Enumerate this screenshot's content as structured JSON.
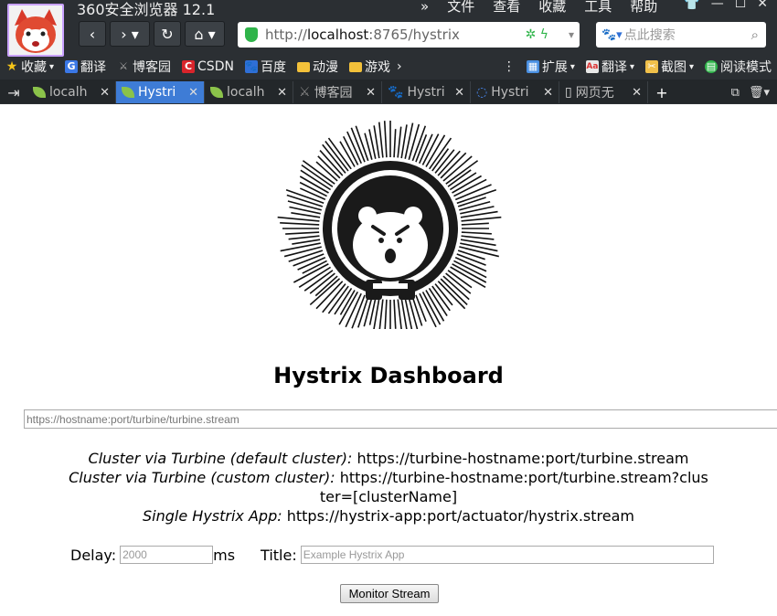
{
  "browser": {
    "app_title": "360安全浏览器 12.1",
    "menu": [
      "文件",
      "查看",
      "收藏",
      "工具",
      "帮助"
    ],
    "window_controls": [
      "—",
      "☐",
      "✕"
    ],
    "address_prefix": "http://",
    "address_host": "localhost",
    "address_rest": ":8765/hystrix",
    "search_placeholder": "点此搜索",
    "bookmarks_left": [
      {
        "label": "收藏",
        "icon": "star-icon"
      },
      {
        "label": "翻译",
        "icon": "translate-icon"
      },
      {
        "label": "博客园",
        "icon": "blog-icon"
      },
      {
        "label": "CSDN",
        "icon": "csdn-icon"
      },
      {
        "label": "百度",
        "icon": "baidu-icon"
      },
      {
        "label": "动漫",
        "icon": "folder-icon"
      },
      {
        "label": "游戏",
        "icon": "folder-icon"
      }
    ],
    "bookmarks_right": [
      {
        "label": "扩展",
        "icon": "extensions-icon"
      },
      {
        "label": "翻译",
        "icon": "translate-icon"
      },
      {
        "label": "截图",
        "icon": "screenshot-icon"
      },
      {
        "label": "阅读模式",
        "icon": "reader-icon"
      }
    ],
    "tabs": [
      {
        "label": "localh",
        "icon": "leaf-icon",
        "active": false
      },
      {
        "label": "Hystri",
        "icon": "leaf-icon",
        "active": true
      },
      {
        "label": "localh",
        "icon": "leaf-icon",
        "active": false
      },
      {
        "label": "博客园",
        "icon": "blog-icon",
        "active": false
      },
      {
        "label": "Hystri",
        "icon": "baidu-icon",
        "active": false
      },
      {
        "label": "Hystri",
        "icon": "loading-icon",
        "active": false
      },
      {
        "label": "网页无",
        "icon": "page-icon",
        "active": false
      }
    ]
  },
  "dashboard": {
    "title": "Hystrix Dashboard",
    "stream_placeholder": "https://hostname:port/turbine/turbine.stream",
    "examples": [
      {
        "label": "Cluster via Turbine (default cluster):",
        "value": "https://turbine-hostname:port/turbine.stream"
      },
      {
        "label": "Cluster via Turbine (custom cluster):",
        "value": "https://turbine-hostname:port/turbine.stream?cluster=[clusterName]"
      },
      {
        "label": "Single Hystrix App:",
        "value": "https://hystrix-app:port/actuator/hystrix.stream"
      }
    ],
    "delay_label": "Delay:",
    "delay_placeholder": "2000",
    "delay_unit": "ms",
    "title_label": "Title:",
    "title_placeholder": "Example Hystrix App",
    "monitor_button": "Monitor Stream"
  }
}
